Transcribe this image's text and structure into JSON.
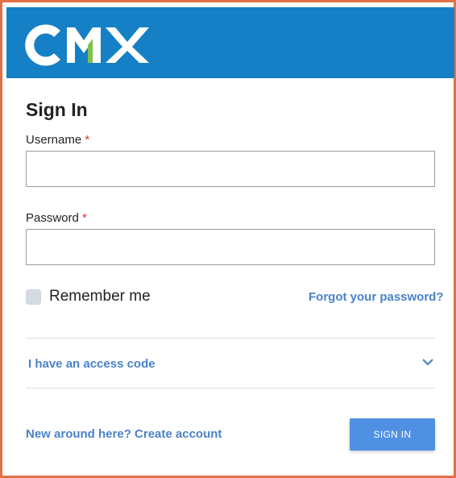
{
  "header": {
    "logo_text": "CMX",
    "background_color": "#1580c5",
    "logo_accent_color": "#7cc24a"
  },
  "form": {
    "title": "Sign In",
    "username": {
      "label": "Username",
      "required_mark": "*",
      "value": "",
      "placeholder": ""
    },
    "password": {
      "label": "Password",
      "required_mark": "*",
      "value": "",
      "placeholder": ""
    },
    "remember_me": {
      "label": "Remember me",
      "checked": false
    },
    "forgot_password_link": "Forgot your password?",
    "access_code": {
      "label": "I have an access code",
      "icon": "chevron-down-icon",
      "expanded": false
    },
    "create_account_link": "New around here? Create account",
    "submit_label": "SIGN IN"
  },
  "colors": {
    "link": "#4a82c8",
    "button": "#5090e3",
    "required": "#d23a2e",
    "border_accent": "#e07046"
  }
}
